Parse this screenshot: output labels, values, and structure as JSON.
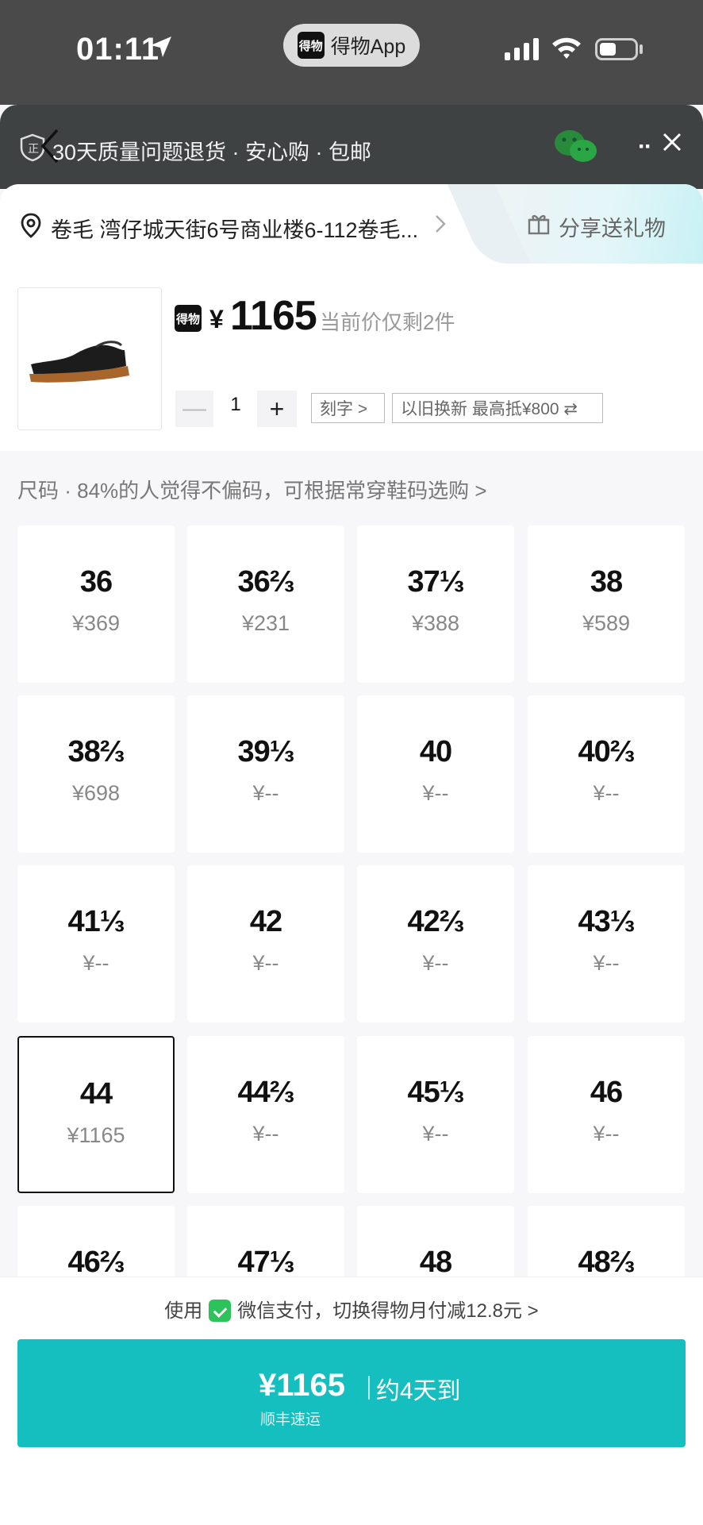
{
  "status_bar": {
    "time": "01:11",
    "app_name": "得物App",
    "app_logo": "得物"
  },
  "top_bar": {
    "guarantee": "30天质量问题退货 · 安心购 · 包邮",
    "more": "··"
  },
  "address": {
    "text": "卷毛 湾仔城天街6号商业楼6-112卷毛...",
    "share": "分享送礼物"
  },
  "product": {
    "brand": "得物",
    "currency": "¥",
    "price": "1165",
    "note": "当前价仅剩2件",
    "quantity": "1",
    "minus": "—",
    "plus": "+",
    "engrave": "刻字 >",
    "trade_in": "以旧换新 最高抵¥800 ⇄"
  },
  "size_hint": "尺码 · 84%的人觉得不偏码，可根据常穿鞋码选购 >",
  "sizes": [
    {
      "size": "36",
      "price": "¥369"
    },
    {
      "size": "36⅔",
      "price": "¥231"
    },
    {
      "size": "37⅓",
      "price": "¥388"
    },
    {
      "size": "38",
      "price": "¥589"
    },
    {
      "size": "38⅔",
      "price": "¥698"
    },
    {
      "size": "39⅓",
      "price": "¥--"
    },
    {
      "size": "40",
      "price": "¥--"
    },
    {
      "size": "40⅔",
      "price": "¥--"
    },
    {
      "size": "41⅓",
      "price": "¥--"
    },
    {
      "size": "42",
      "price": "¥--"
    },
    {
      "size": "42⅔",
      "price": "¥--"
    },
    {
      "size": "43⅓",
      "price": "¥--"
    },
    {
      "size": "44",
      "price": "¥1165",
      "selected": true
    },
    {
      "size": "44⅔",
      "price": "¥--"
    },
    {
      "size": "45⅓",
      "price": "¥--"
    },
    {
      "size": "46",
      "price": "¥--"
    },
    {
      "size": "46⅔",
      "price": ""
    },
    {
      "size": "47⅓",
      "price": ""
    },
    {
      "size": "48",
      "price": ""
    },
    {
      "size": "48⅔",
      "price": ""
    }
  ],
  "footer": {
    "pay_prefix": "使用",
    "pay_text": "微信支付，切换得物月付减12.8元 >",
    "buy_price": "¥1165",
    "eta": "约4天到",
    "shipping": "顺丰速运"
  },
  "colors": {
    "accent": "#16bfbf",
    "wechat_green": "#2cc35a"
  }
}
